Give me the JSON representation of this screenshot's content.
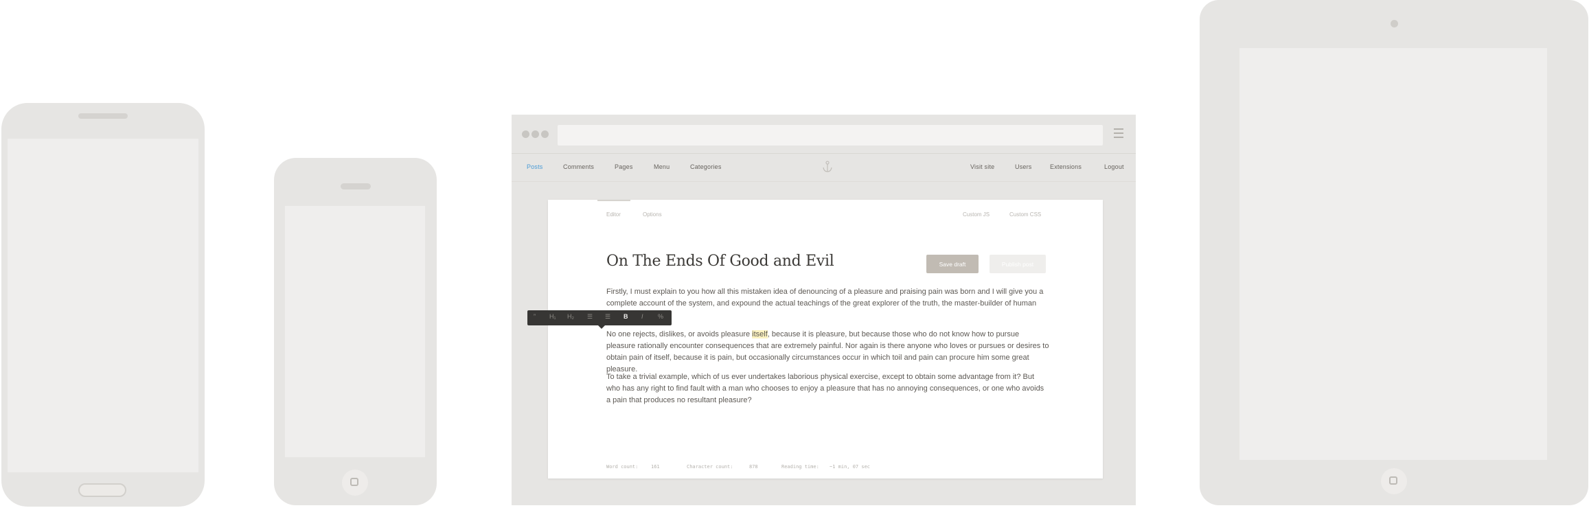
{
  "nav": {
    "left": [
      "Posts",
      "Comments",
      "Pages",
      "Menu",
      "Categories"
    ],
    "right": [
      "Visit site",
      "Users",
      "Extensions",
      "Logout"
    ],
    "active": "Posts"
  },
  "editor": {
    "tabs": [
      "Editor",
      "Options"
    ],
    "right_tabs": [
      "Custom JS",
      "Custom CSS"
    ],
    "title": "On The Ends Of Good and Evil",
    "save_label": "Save draft",
    "publish_label": "Publish post",
    "paragraphs": {
      "p1_a": "Firstly, I must explain to you how all this mistaken idea of denouncing of a pleasure and praising pain was born and I will give you a complete account of the system, and expound the actual teachings of the great explorer of the truth, the master-builder of human happin",
      "p2_before": "No one rejects, dislikes, or avoids pleasure ",
      "p2_highlight": "itself",
      "p2_after": ", because it is pleasure, but because those who do not know how to pursue pleasure rationally encounter consequences that are extremely painful. Nor again is there anyone who loves or pursues or desires to obtain pain of itself, because it is pain, but occasionally circumstances occur in which toil and pain can procure him some great pleasure.",
      "p3": "To take a trivial example, which of us ever undertakes laborious physical exercise, except to obtain some advantage from it? But who has any right to find fault with a man who chooses to enjoy a pleasure that has no annoying consequences, or one who avoids a pain that produces no resultant pleasure?"
    },
    "toolbar": {
      "quote": "”",
      "h1": "H₁",
      "h2": "H₂",
      "ol": "☰",
      "ul": "☰",
      "bold": "B",
      "italic": "I",
      "link": "%"
    },
    "stats": {
      "word_label": "Word count:",
      "word_value": "161",
      "char_label": "Character count:",
      "char_value": "878",
      "read_label": "Reading time:",
      "read_value": "~1 min, 07 sec"
    }
  },
  "colors": {
    "accent": "#4a9bd6",
    "device": "#e6e5e3",
    "highlight": "#fbf2c1"
  }
}
